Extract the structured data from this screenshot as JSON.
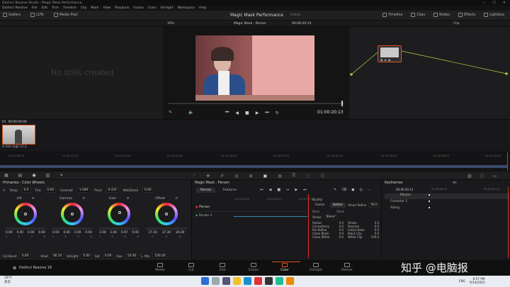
{
  "window": {
    "title": "DaVinci Resolve Studio - Magic Mask Performance",
    "controls": [
      "─",
      "☐",
      "✕"
    ]
  },
  "menu": [
    "DaVinci Resolve",
    "File",
    "Edit",
    "Trim",
    "Timeline",
    "Clip",
    "Mark",
    "View",
    "Playback",
    "Fusion",
    "Color",
    "Fairlight",
    "Workspace",
    "Help"
  ],
  "toolbar": {
    "gallery": "Gallery",
    "luts": "LUTs",
    "media_pool": "Media Pool",
    "project_title": "Magic Mask Performance",
    "edited": "Edited",
    "timeline": "Timeline",
    "clips": "Clips",
    "nodes": "Nodes",
    "effects": "Effects",
    "lightbox": "Lightbox"
  },
  "viewer": {
    "zoom": "39%",
    "title": "Magic Mask - Person",
    "timecode": "00:00:20:13",
    "clip_mode": "Clip",
    "playhead_timecode": "01:00:20:13"
  },
  "gallery": {
    "empty_text": "No stills created"
  },
  "clips": {
    "items": [
      {
        "index": "01",
        "timecode": "00:00:00:00",
        "codec": "H.264 High L5.2"
      }
    ]
  },
  "timeline": {
    "ticks": [
      "01:00:00:00",
      "01:00:07:00",
      "01:00:14:00",
      "01:00:21:00",
      "01:00:28:00",
      "01:00:35:00",
      "01:00:42:00",
      "01:00:49:00",
      "01:00:56:00",
      "01:01:03:00"
    ]
  },
  "primaries": {
    "title": "Primaries - Color Wheels",
    "top_fields": [
      {
        "label": "Temp",
        "value": "0.0"
      },
      {
        "label": "Tint",
        "value": "0.00"
      },
      {
        "label": "Contrast",
        "value": "1.000"
      },
      {
        "label": "Pivot",
        "value": "0.435"
      },
      {
        "label": "Mid/Detail",
        "value": "0.00"
      }
    ],
    "wheels": [
      {
        "name": "Lift",
        "values": [
          "0.00",
          "0.00",
          "0.00",
          "0.00"
        ],
        "letters": [
          "Y",
          "R",
          "G",
          "B"
        ]
      },
      {
        "name": "Gamma",
        "values": [
          "0.00",
          "0.00",
          "0.00",
          "0.00"
        ],
        "letters": [
          "Y",
          "R",
          "G",
          "B"
        ]
      },
      {
        "name": "Gain",
        "values": [
          "1.00",
          "1.04",
          "0.97",
          "0.00"
        ],
        "letters": [
          "Y",
          "R",
          "G",
          "B"
        ]
      },
      {
        "name": "Offset",
        "values": [
          "",
          "27.30",
          "27.30",
          "26.00"
        ],
        "letters": [
          "R",
          "G",
          "B"
        ]
      }
    ],
    "bottom_fields": [
      {
        "label": "Col Boost",
        "value": "0.00"
      },
      {
        "label": "Shad",
        "value": "06.50"
      },
      {
        "label": "Hi/Light",
        "value": "0.00"
      },
      {
        "label": "Sat",
        "value": "0.00"
      },
      {
        "label": "Hue",
        "value": "50.00"
      },
      {
        "label": "L. Mix",
        "value": "100.00"
      }
    ]
  },
  "magic_mask": {
    "title": "Magic Mask - Person",
    "mode_tabs": [
      "Person",
      "Features"
    ],
    "tracks": [
      "Person",
      "Stroke 1"
    ],
    "ruler_ticks": [
      "00:00:00:00",
      "00:00:08:15",
      "00:00:17:06"
    ],
    "quality_label": "Quality",
    "quality_options": [
      "Faster",
      "Better"
    ],
    "smart_refine_label": "Smart Refine",
    "smart_refine_value": "50.0",
    "mask_label": "Mask",
    "mode_label": "Mode",
    "mode_value": "Blend",
    "left_params": [
      {
        "label": "Radius",
        "value": "0.0"
      },
      {
        "label": "Consistency",
        "value": "0.0"
      },
      {
        "label": "Pre-Refine",
        "value": "0.0"
      },
      {
        "label": "Clean Black",
        "value": "0.0"
      },
      {
        "label": "Clean White",
        "value": "0.0"
      }
    ],
    "right_params_header": "Stroke",
    "right_params": [
      {
        "label": "Stroke",
        "value": "0.0"
      },
      {
        "label": "Denoise",
        "value": "0.0"
      },
      {
        "label": "In/Out Ratio",
        "value": "0.0"
      },
      {
        "label": "Black Clip",
        "value": "0.0"
      },
      {
        "label": "White Clip",
        "value": "100.0"
      }
    ]
  },
  "keyframes": {
    "title": "Keyframes",
    "filter": "All",
    "timecode_left": "00:00:20:13",
    "timecode_ruler_left": "00:00:00:00",
    "timecode_ruler_right": "00:00:20:13",
    "rows": [
      "Master",
      "Corrector 1",
      "Sizing"
    ]
  },
  "pages": [
    "Media",
    "Cut",
    "Edit",
    "Fusion",
    "Color",
    "Fairlight",
    "Deliver"
  ],
  "active_page": "Color",
  "brand": "DaVinci Resolve 18",
  "taskbar": {
    "weather_temp": "29°C",
    "weather_desc": "多云",
    "lang": "ENG",
    "time": "8:57 PM",
    "date": "9/14/2022"
  },
  "watermark": "知乎 @电脑报",
  "colors": {
    "accent": "#e0541e",
    "viewer_mask": "#e9a7a7",
    "playhead": "#e03020",
    "node_line": "#c8c840"
  }
}
